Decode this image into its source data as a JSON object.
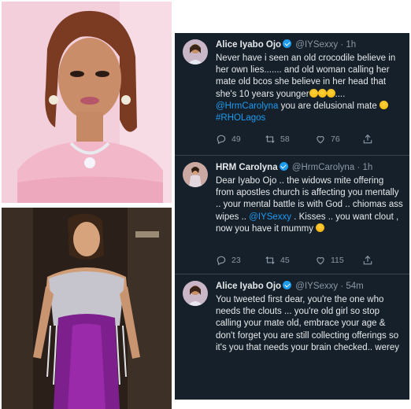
{
  "tweets": [
    {
      "author_name": "Alice Iyabo Ojo",
      "handle": "@IYSexxy",
      "time": "· 1h",
      "text_parts": [
        "Never have i seen an old crocodile believe in her own lies....... and old woman calling her mate old bcos she believe in her head that she's 10 years younger",
        "....",
        "@HrmCarolyna",
        " you are delusional mate ",
        "#RHOLagos"
      ],
      "replies": "49",
      "retweets": "58",
      "likes": "76"
    },
    {
      "author_name": "HRM Carolyna",
      "handle": "@HrmCarolyna",
      "time": "· 1h",
      "text_parts": [
        "Dear Iyabo Ojo .. the widows mite offering from apostles church is affecting you mentally .. your mental battle is with God .. chiomas ass wipes .. ",
        "@IYSexxy",
        " . Kisses .. you want clout , now you have it mummy "
      ],
      "replies": "23",
      "retweets": "45",
      "likes": "115"
    },
    {
      "author_name": "Alice Iyabo Ojo",
      "handle": "@IYSexxy",
      "time": "· 54m",
      "text": "You tweeted first dear, you're the one who needs the clouts ... you're old girl so stop calling your mate old, embrace your age & don't forget you are still collecting offerings so it's you that needs your brain checked.. werey"
    }
  ],
  "icons": {
    "reply": "reply-icon",
    "retweet": "retweet-icon",
    "like": "heart-icon",
    "share": "share-icon",
    "verified": "verified-badge-icon"
  },
  "colors": {
    "panel_bg": "#15202b",
    "text": "#e7e9ea",
    "muted": "#8b98a5",
    "link": "#1d9bf0",
    "divider": "#38444d"
  }
}
